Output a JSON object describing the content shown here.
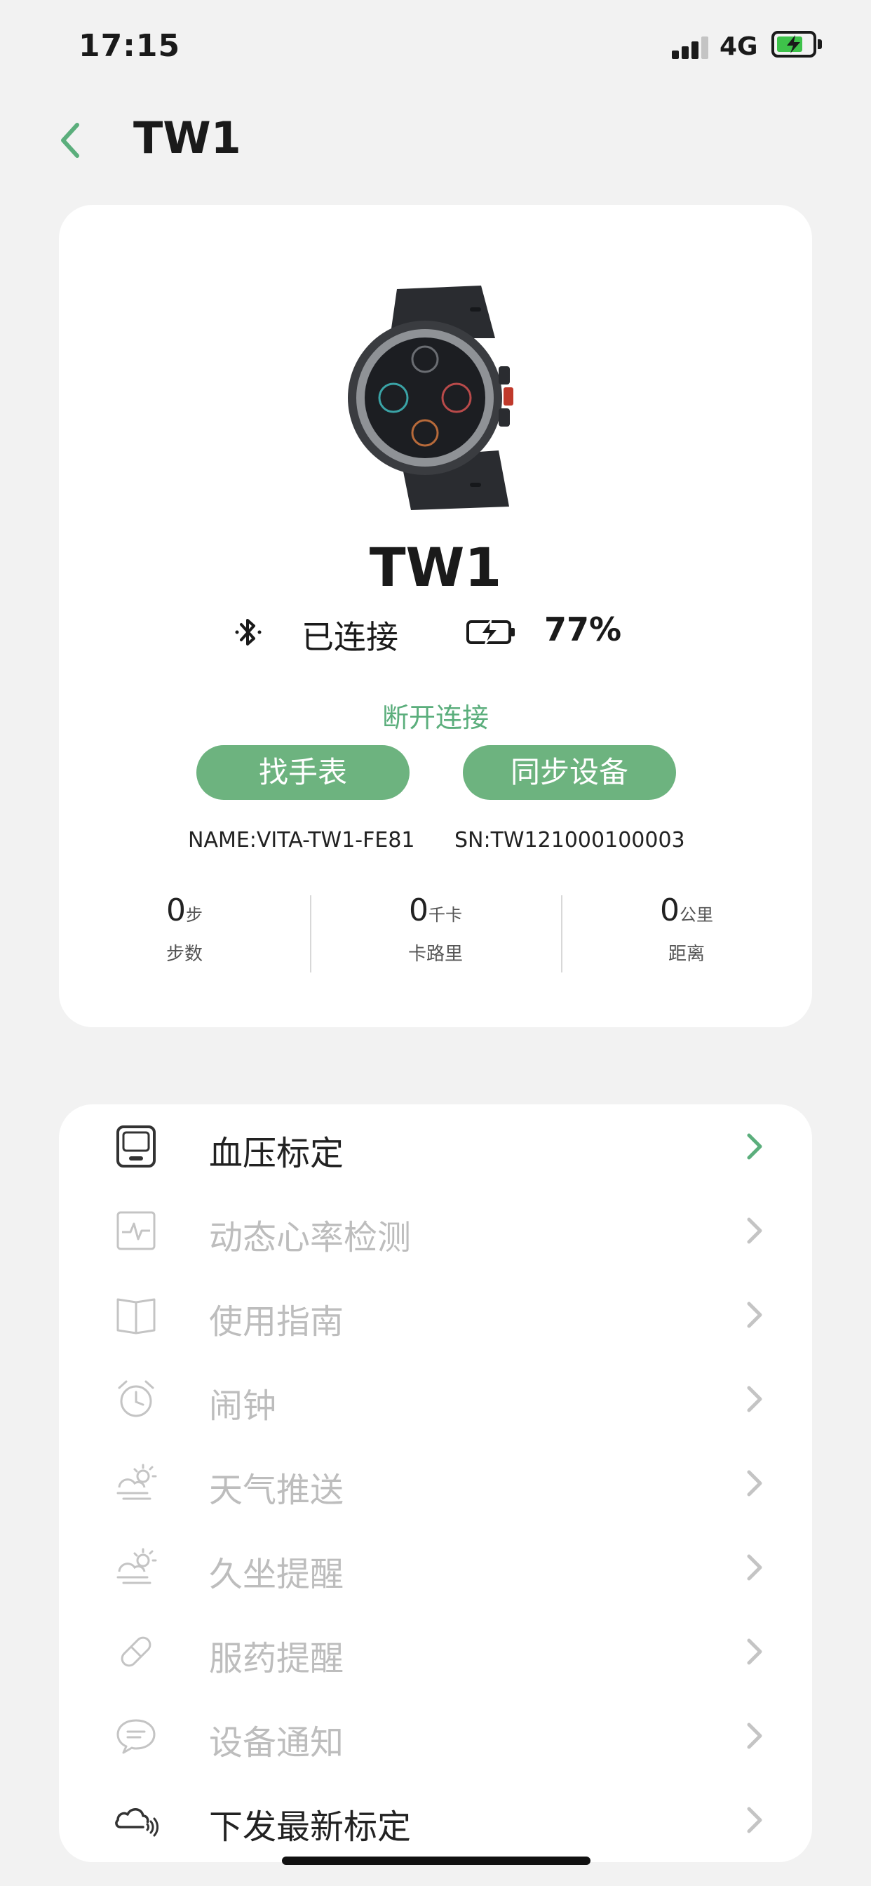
{
  "status_bar": {
    "time": "17:15",
    "network": "4G"
  },
  "nav": {
    "title": "TW1"
  },
  "device": {
    "name": "TW1",
    "connection_status": "已连接",
    "battery": "77%",
    "disconnect_label": "断开连接",
    "find_watch_label": "找手表",
    "sync_label": "同步设备",
    "name_info": "NAME:VITA-TW1-FE81",
    "sn_info": "SN:TW121000100003"
  },
  "stats": [
    {
      "value": "0",
      "unit": "步",
      "label": "步数"
    },
    {
      "value": "0",
      "unit": "千卡",
      "label": "卡路里"
    },
    {
      "value": "0",
      "unit": "公里",
      "label": "距离"
    }
  ],
  "menu": [
    {
      "label": "血压标定",
      "icon": "blood-pressure-device-icon"
    },
    {
      "label": "动态心率检测",
      "icon": "heart-rate-icon"
    },
    {
      "label": "使用指南",
      "icon": "book-icon"
    },
    {
      "label": "闹钟",
      "icon": "alarm-clock-icon"
    },
    {
      "label": "天气推送",
      "icon": "weather-icon"
    },
    {
      "label": "久坐提醒",
      "icon": "sedentary-weather-icon"
    },
    {
      "label": "服药提醒",
      "icon": "pill-icon"
    },
    {
      "label": "设备通知",
      "icon": "message-icon"
    },
    {
      "label": "下发最新标定",
      "icon": "cloud-signal-icon"
    }
  ],
  "colors": {
    "accent": "#6db37f",
    "accent_text": "#5bae7c",
    "inactive_text": "#bdbdbd",
    "background": "#f2f2f2"
  }
}
